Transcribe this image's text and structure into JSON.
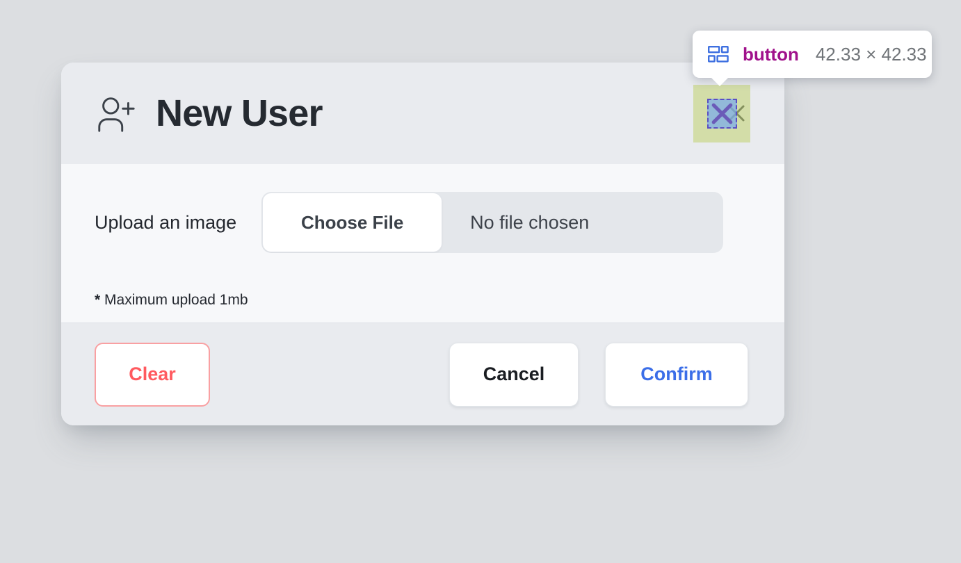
{
  "dialog": {
    "title": "New User",
    "title_icon": "user-plus-icon",
    "close_icon": "close-x-icon",
    "body": {
      "upload_label": "Upload an image",
      "choose_file_label": "Choose File",
      "no_file_text": "No file chosen",
      "note_star": "*",
      "note_text": " Maximum upload 1mb"
    },
    "footer": {
      "clear_label": "Clear",
      "cancel_label": "Cancel",
      "confirm_label": "Confirm"
    }
  },
  "inspector": {
    "icon": "layout-grid-icon",
    "tag": "button",
    "dimensions": "42.33 × 42.33",
    "target": "close-button"
  },
  "colors": {
    "page_background": "#dcdee1",
    "dialog_header": "#e9ebef",
    "dialog_body": "#f7f8fa",
    "dialog_footer": "#e9ebef",
    "clear_accent": "#ff5a5f",
    "confirm_accent": "#3b6ee8",
    "tooltip_tag": "#a0118b",
    "tooltip_dims": "#707478",
    "highlight_outer": "#c1d16e",
    "highlight_inner": "#78aaeb",
    "highlight_border": "#5b4ec4"
  }
}
